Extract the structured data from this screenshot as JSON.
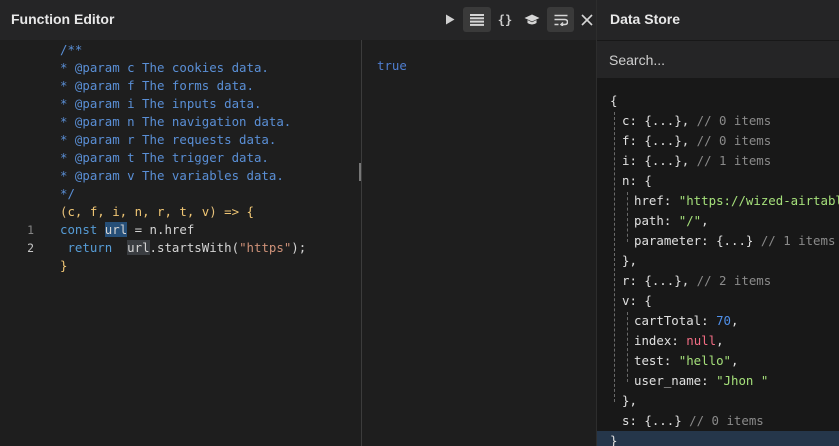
{
  "function_editor": {
    "title": "Function Editor",
    "toolbar": {
      "run_icon": "play-icon",
      "list_icon": "list-icon",
      "braces_label": "{}",
      "docs_icon": "graduation-cap-icon",
      "wrap_icon": "word-wrap-icon",
      "close_icon": "close-icon"
    },
    "doc_comment": [
      "/**",
      "* @param c The cookies data.",
      "* @param f The forms data.",
      "* @param i The inputs data.",
      "* @param n The navigation data.",
      "* @param r The requests data.",
      "* @param t The trigger data.",
      "* @param v The variables data.",
      "*/"
    ],
    "signature": {
      "open": "(",
      "params": "c, f, i, n, r, t, v",
      "close": ")",
      "arrow": " => {"
    },
    "code": {
      "line1": {
        "number": "1",
        "keyword": "const",
        "var": "url",
        "rest": " = n.href"
      },
      "line2": {
        "number": "2",
        "keyword": "return",
        "var": "url",
        "method": ".startsWith(",
        "string": "\"https\"",
        "end": ");"
      },
      "closing": "}"
    },
    "output": {
      "value": "true"
    }
  },
  "data_store": {
    "title": "Data Store",
    "search_placeholder": "Search...",
    "tree": {
      "open": "{",
      "c": {
        "key": "c",
        "value": "{...}",
        "comment": "// 0 items"
      },
      "f": {
        "key": "f",
        "value": "{...}",
        "comment": "// 0 items"
      },
      "i": {
        "key": "i",
        "value": "{...}",
        "comment": "// 1 items"
      },
      "n": {
        "key": "n",
        "open": "{",
        "href": {
          "key": "href",
          "value": "\"https://wized-airtabl"
        },
        "path": {
          "key": "path",
          "value": "\"/\""
        },
        "parameter": {
          "key": "parameter",
          "value": "{...}",
          "comment": "// 1 items"
        },
        "close": "},"
      },
      "r": {
        "key": "r",
        "value": "{...}",
        "comment": "// 2 items"
      },
      "v": {
        "key": "v",
        "open": "{",
        "cartTotal": {
          "key": "cartTotal",
          "value": "70"
        },
        "index": {
          "key": "index",
          "value": "null"
        },
        "test": {
          "key": "test",
          "value": "\"hello\""
        },
        "user_name": {
          "key": "user_name",
          "value": "\"Jhon \""
        },
        "close": "},"
      },
      "s": {
        "key": "s",
        "value": "{...}",
        "comment": "// 0 items"
      },
      "close": "}"
    }
  }
}
